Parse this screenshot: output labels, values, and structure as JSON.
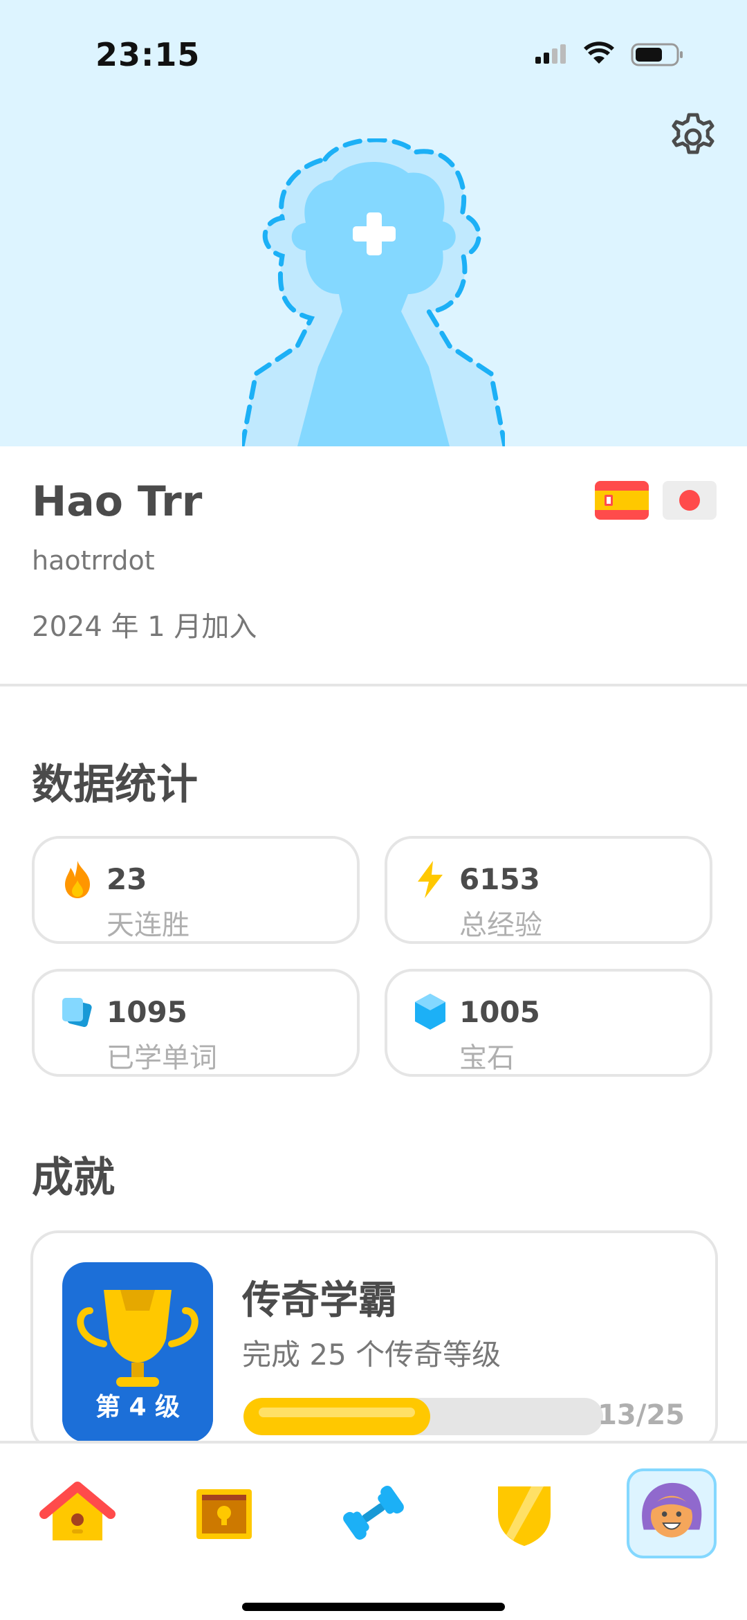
{
  "status_bar": {
    "time": "23:15"
  },
  "profile": {
    "name": "Hao Trr",
    "username": "haotrrdot",
    "joined": "2024 年 1 月加入"
  },
  "stats": {
    "title": "数据统计",
    "items": [
      {
        "value": "23",
        "label": "天连胜",
        "icon": "flame-icon"
      },
      {
        "value": "6153",
        "label": "总经验",
        "icon": "lightning-icon"
      },
      {
        "value": "1095",
        "label": "已学单词",
        "icon": "cards-icon"
      },
      {
        "value": "1005",
        "label": "宝石",
        "icon": "gem-icon"
      }
    ]
  },
  "achievements": {
    "title": "成就",
    "items": [
      {
        "badge_label": "第 4 级",
        "title": "传奇学霸",
        "description": "完成 25 个传奇等级",
        "progress_text": "13/25",
        "progress": 0.52
      }
    ]
  },
  "tabs": [
    "home-tab",
    "treasure-tab",
    "practice-tab",
    "league-tab",
    "profile-tab"
  ],
  "colors": {
    "hero_bg": "#ddf4ff",
    "accent_blue": "#1cb0f6",
    "gold": "#ffc800",
    "border": "#e5e5e5"
  }
}
